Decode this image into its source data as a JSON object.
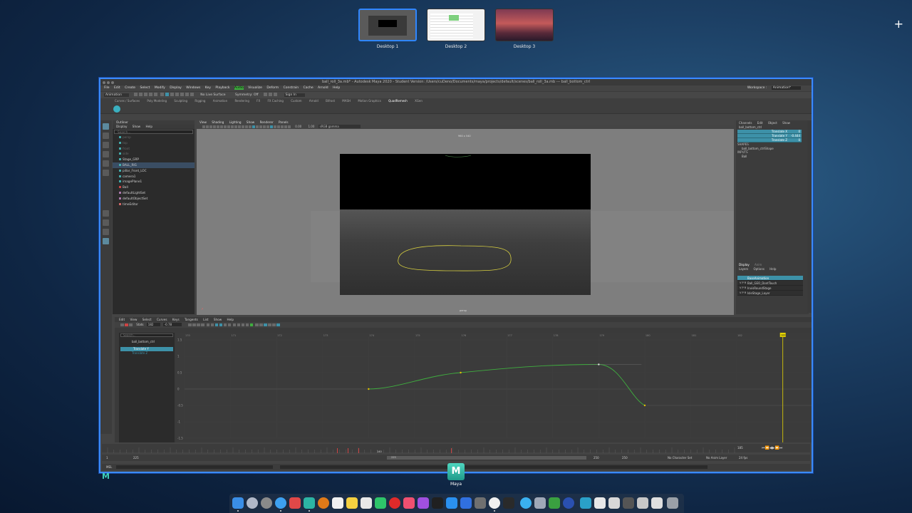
{
  "spaces": [
    {
      "label": "Desktop 1",
      "active": true
    },
    {
      "label": "Desktop 2",
      "active": false
    },
    {
      "label": "Desktop 3",
      "active": false
    }
  ],
  "add_space": "+",
  "window": {
    "title": "ball_roll_3a.mb* - Autodesk Maya 2020 - Student Version: /Users/cuDeno/Documents/maya/projects/default/scenes/ball_roll_3a.mb  ---  ball_bottom_ctrl",
    "menus": [
      "File",
      "Edit",
      "Create",
      "Select",
      "Modify",
      "Display",
      "Windows",
      "Key",
      "Playback",
      "Audio",
      "Visualize",
      "Deform",
      "Constrain",
      "Cache",
      "Arnold",
      "Help"
    ],
    "workspace_label": "Workspace :",
    "workspace_value": "Animation*",
    "mode_value": "Animation",
    "no_live_surface": "No Live Surface",
    "symmetry": "Symmetry: Off",
    "sign_in": "Sign In",
    "shelf_tabs": [
      "Curves / Surfaces",
      "Poly Modeling",
      "Sculpting",
      "Rigging",
      "Animation",
      "Rendering",
      "FX",
      "FX Caching",
      "Custom",
      "Arnold",
      "Bifrost",
      "MASH",
      "Motion Graphics",
      "QuadRemesh",
      "XGen"
    ],
    "shelf_active": "QuadRemesh"
  },
  "outliner": {
    "title": "Outliner",
    "menus": [
      "Display",
      "Show",
      "Help"
    ],
    "search_placeholder": "Search...",
    "items": [
      {
        "label": "persp",
        "dim": true
      },
      {
        "label": "top",
        "dim": true
      },
      {
        "label": "front",
        "dim": true
      },
      {
        "label": "side",
        "dim": true
      },
      {
        "label": "Stage_GRP",
        "dim": false
      },
      {
        "label": "BALL_RIG",
        "dim": false
      },
      {
        "label": "pillar_Front_LOC",
        "dim": false
      },
      {
        "label": "camera1",
        "dim": false
      },
      {
        "label": "imagePlane1",
        "dim": false
      },
      {
        "label": "Ball",
        "dim": false
      },
      {
        "label": "defaultLightSet",
        "dim": false
      },
      {
        "label": "defaultObjectSet",
        "dim": false
      },
      {
        "label": "timeEditor",
        "dim": false
      }
    ]
  },
  "viewport": {
    "menus": [
      "View",
      "Shading",
      "Lighting",
      "Show",
      "Renderer",
      "Panels"
    ],
    "resolution": "960 x 540",
    "camera_label": "persp",
    "gamma": "sRGB gamma",
    "exposure": "0.00",
    "gamma_val": "1.00"
  },
  "channel_box": {
    "menus": [
      "Channels",
      "Edit",
      "Object",
      "Show"
    ],
    "object_name": "ball_bottom_ctrl",
    "channels": [
      {
        "name": "Translate X",
        "value": "0"
      },
      {
        "name": "Translate Y",
        "value": "-0.444"
      },
      {
        "name": "Translate Z",
        "value": "0"
      }
    ],
    "shapes_label": "SHAPES",
    "shape_name": "ball_bottom_ctrlShape",
    "inputs_label": "INPUTS",
    "input_name": "Ball",
    "layer_tabs": [
      "Display",
      "Anim"
    ],
    "layer_menus": [
      "Layers",
      "Options",
      "Help"
    ],
    "layers": [
      {
        "vpr": "",
        "name": "BaseAnimation",
        "sel": true
      },
      {
        "vpr": "V P R",
        "name": "Ball_GEO_DontTouch",
        "sel": false
      },
      {
        "vpr": "V P R",
        "name": "InvisRoundStage",
        "sel": false
      },
      {
        "vpr": "V P R",
        "name": "IsleStage_Layer",
        "sel": false
      }
    ]
  },
  "graph_editor": {
    "menus": [
      "Edit",
      "View",
      "Select",
      "Curves",
      "Keys",
      "Tangents",
      "List",
      "Show",
      "Help"
    ],
    "stats_label": "Stats",
    "stats_frame": "182",
    "stats_value": "-0.78",
    "search_placeholder": "Search...",
    "items": [
      {
        "label": "ball_bottom_ctrl",
        "style": "normal"
      },
      {
        "label": "Translate Y",
        "style": "sel"
      },
      {
        "label": "Translate Z",
        "style": "blue"
      }
    ],
    "y_ticks": [
      "1.5",
      "1",
      "0.5",
      "0",
      "-0.5",
      "-1",
      "-1.5"
    ],
    "x_ticks": [
      "170",
      "171",
      "172",
      "173",
      "174",
      "175",
      "176",
      "177",
      "178",
      "179",
      "180",
      "181",
      "182"
    ],
    "keys": [
      {
        "frame": 174,
        "value": 0
      },
      {
        "frame": 176,
        "value": 0.5
      },
      {
        "frame": 179,
        "value": 0.75
      },
      {
        "frame": 180,
        "value": -0.5
      }
    ],
    "current_frame": "183"
  },
  "time_slider": {
    "start": "1",
    "range_start": "225",
    "range_end": "250",
    "end": "250",
    "end2": "250",
    "current": "185",
    "playhead_label": "140",
    "character_set": "No Character Set",
    "anim_layer": "No Anim Layer",
    "fps": "24 fps",
    "range_label": "225"
  },
  "command_line": {
    "label": "MEL"
  },
  "dock": {
    "app_label": "Maya",
    "app_letter": "M"
  },
  "colors": {
    "accent": "#3b8bff",
    "selection": "#3d91a8",
    "curve": "#3fae3f",
    "playhead": "#e6d400"
  }
}
